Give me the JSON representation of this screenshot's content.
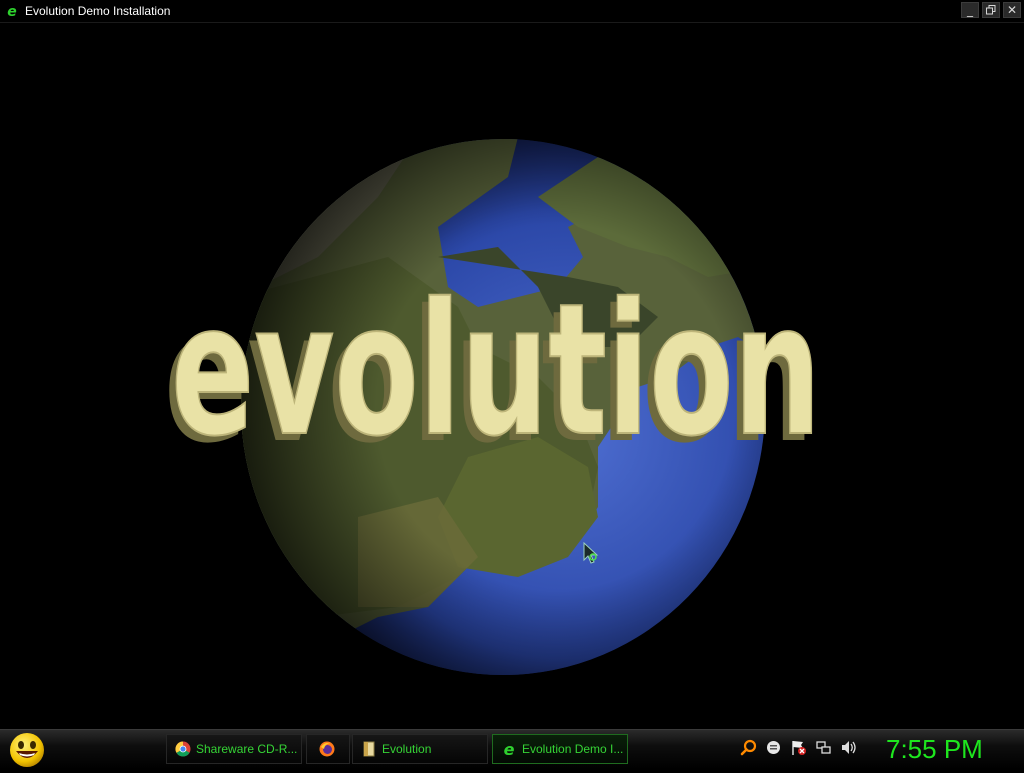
{
  "window": {
    "title": "Evolution Demo Installation",
    "icon": "evolution-e-icon",
    "controls": [
      "minimize-icon",
      "restore-icon",
      "close-icon"
    ]
  },
  "splash": {
    "logo_text": "evolution",
    "background_image": "earth-globe"
  },
  "taskbar": {
    "start_icon": "smiley-face-icon",
    "items": [
      {
        "label": "Shareware CD-R...",
        "icon": "chrome-icon",
        "active": false
      },
      {
        "label": "",
        "icon": "firefox-icon",
        "active": false
      },
      {
        "label": "Evolution",
        "icon": "folder-icon",
        "active": false
      },
      {
        "label": "Evolution Demo I...",
        "icon": "evolution-e-icon",
        "active": true
      }
    ],
    "tray_icons": [
      "search-icon",
      "messenger-icon",
      "action-center-flag-icon",
      "network-icon",
      "volume-icon"
    ],
    "clock": "7:55 PM"
  },
  "colors": {
    "taskbar_text": "#35d435",
    "clock": "#1ee61e",
    "logo_face": "#e9e2a6"
  }
}
